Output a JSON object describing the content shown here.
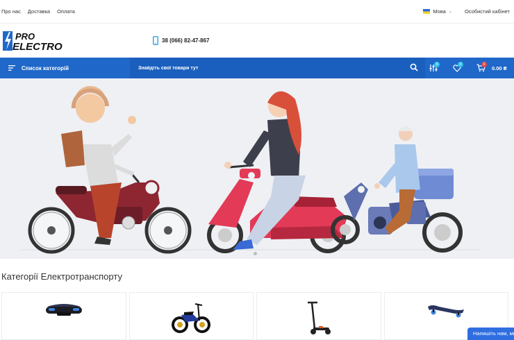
{
  "topbar": {
    "nav": [
      "Про нас",
      "Доставка",
      "Оплата"
    ],
    "language": "Мова",
    "account": "Особистий кабінет"
  },
  "header": {
    "logo_line1": "PRO",
    "logo_line2": "ELECTRO",
    "phone": "38 (066) 82-47-867"
  },
  "navbar": {
    "categories_label": "Список категорій",
    "search_placeholder": "Знайдіть свої товари тут",
    "compare_count": "0",
    "wishlist_count": "0",
    "cart_count": "0",
    "cart_total": "0.00 ₴"
  },
  "section": {
    "title": "Категорії Електротранспорту"
  },
  "chat": {
    "label": "Напишіть нам, ми"
  },
  "colors": {
    "brand_blue": "#1f68c9",
    "search_blue": "#1a5fbd",
    "badge_cyan": "#2ec2f0",
    "badge_red": "#e24747"
  },
  "icons": [
    "phone-icon",
    "menu-icon",
    "search-icon",
    "compare-icon",
    "heart-icon",
    "cart-icon"
  ]
}
